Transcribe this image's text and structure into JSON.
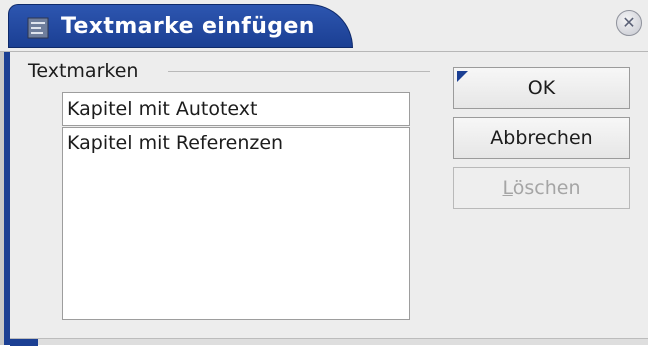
{
  "window": {
    "title": "Textmarke einfügen",
    "close_symbol": "✕"
  },
  "group": {
    "label": "Textmarken"
  },
  "name_input": {
    "value": "Kapitel mit Autotext",
    "placeholder": ""
  },
  "bookmarks": {
    "items": [
      "Kapitel mit Referenzen"
    ]
  },
  "buttons": {
    "ok": "OK",
    "cancel": "Abbrechen",
    "delete_mnemonic": "L",
    "delete_rest": "öschen"
  },
  "colors": {
    "title_blue": "#1b3f93",
    "disabled_text": "#a5a5a5"
  },
  "icons": {
    "app": "document-icon",
    "close": "close-icon",
    "default": "default-button-marker"
  }
}
